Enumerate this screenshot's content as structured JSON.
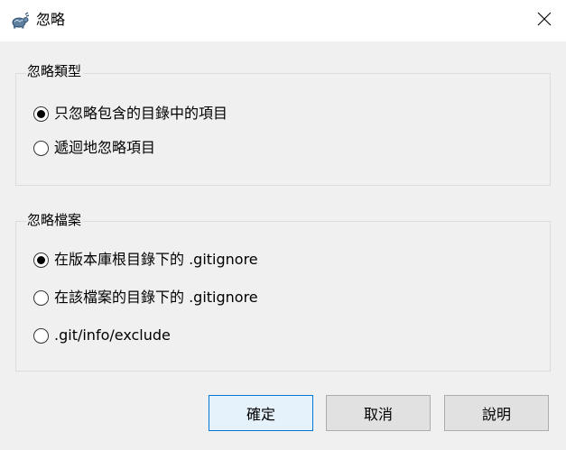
{
  "window": {
    "title": "忽略",
    "app_icon": "tortoise-icon",
    "close_icon": "close-icon"
  },
  "ignore_type": {
    "legend": "忽略類型",
    "options": [
      {
        "label": "只忽略包含的目錄中的項目",
        "checked": true
      },
      {
        "label": "遞迴地忽略項目",
        "checked": false
      }
    ]
  },
  "ignore_file": {
    "legend": "忽略檔案",
    "options": [
      {
        "label": "在版本庫根目錄下的 .gitignore",
        "checked": true
      },
      {
        "label": "在該檔案的目錄下的 .gitignore",
        "checked": false
      },
      {
        "label": ".git/info/exclude",
        "checked": false
      }
    ]
  },
  "buttons": {
    "ok": "確定",
    "cancel": "取消",
    "help": "說明"
  },
  "colors": {
    "default_button_border": "#0078d7",
    "default_button_fill": "#e5f1fb",
    "dialog_background": "#f0f0f0"
  }
}
